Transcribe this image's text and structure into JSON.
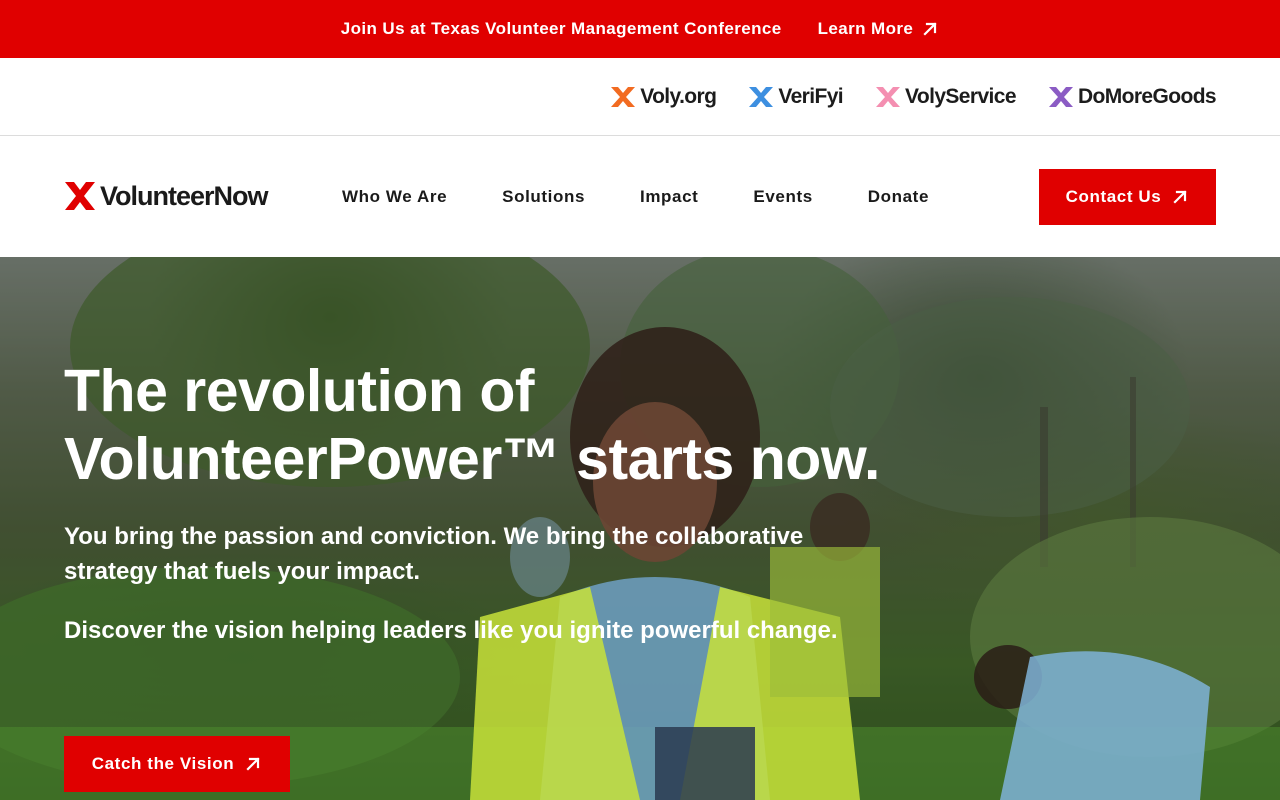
{
  "announcement": {
    "text": "Join Us at Texas Volunteer Management Conference",
    "link_label": "Learn More"
  },
  "brands": [
    {
      "label": "Voly.org",
      "color": "#f26b21"
    },
    {
      "label": "VeriFyi",
      "color": "#3d8fe0"
    },
    {
      "label": "VolyService",
      "color": "#f48fb1"
    },
    {
      "label": "DoMoreGoods",
      "color": "#8b5cc4"
    }
  ],
  "logo": {
    "label": "VolunteerNow",
    "color": "#e00000"
  },
  "nav": {
    "items": [
      "Who We Are",
      "Solutions",
      "Impact",
      "Events",
      "Donate"
    ],
    "contact_label": "Contact Us"
  },
  "hero": {
    "title_line1": "The revolution of",
    "title_line2": "VolunteerPower™ starts now.",
    "subtitle": "You bring the passion and conviction. We bring the collaborative strategy that fuels your impact.",
    "subtitle2": "Discover the vision helping leaders like you ignite powerful change.",
    "cta_label": "Catch the Vision"
  },
  "colors": {
    "accent": "#e00000",
    "text": "#1a1a1a",
    "white": "#ffffff"
  }
}
